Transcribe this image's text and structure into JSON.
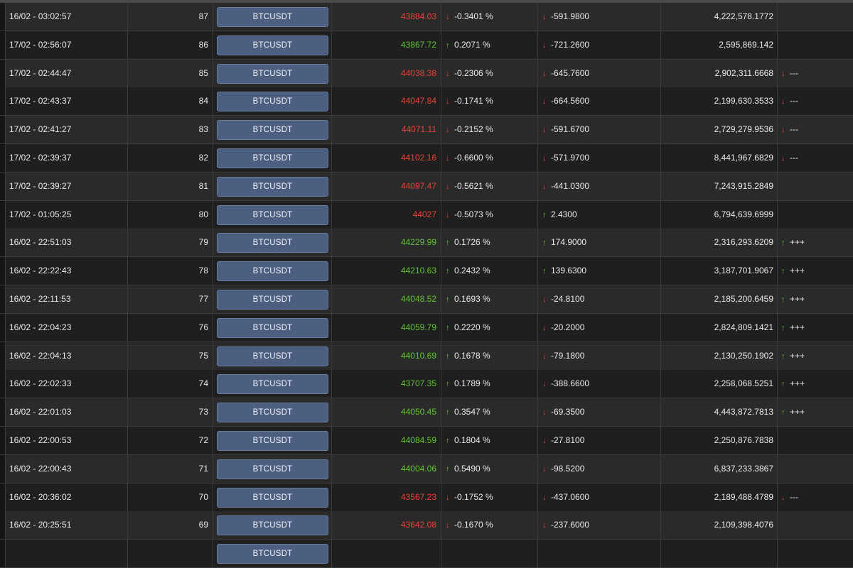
{
  "symbol_label": "BTCUSDT",
  "colors": {
    "up": "#64c23c",
    "down": "#e2463a",
    "button": "#4c5f80"
  },
  "rows": [
    {
      "time": "16/02 - 03:02:57",
      "num": "87",
      "price": "43884.03",
      "price_dir": "down",
      "pct": "-0.3401 %",
      "pct_dir": "down",
      "change": "-591.9800",
      "change_dir": "down",
      "volume": "4,222,578.1772",
      "signal": "",
      "signal_dir": ""
    },
    {
      "time": "17/02 - 02:56:07",
      "num": "86",
      "price": "43867.72",
      "price_dir": "up",
      "pct": "0.2071 %",
      "pct_dir": "up",
      "change": "-721.2600",
      "change_dir": "down",
      "volume": "2,595,869.142",
      "signal": "",
      "signal_dir": ""
    },
    {
      "time": "17/02 - 02:44:47",
      "num": "85",
      "price": "44038.38",
      "price_dir": "down",
      "pct": "-0.2306 %",
      "pct_dir": "down",
      "change": "-645.7600",
      "change_dir": "down",
      "volume": "2,902,311.6668",
      "signal": "---",
      "signal_dir": "down"
    },
    {
      "time": "17/02 - 02:43:37",
      "num": "84",
      "price": "44047.84",
      "price_dir": "down",
      "pct": "-0.1741 %",
      "pct_dir": "down",
      "change": "-664.5600",
      "change_dir": "down",
      "volume": "2,199,630.3533",
      "signal": "---",
      "signal_dir": "down"
    },
    {
      "time": "17/02 - 02:41:27",
      "num": "83",
      "price": "44071.11",
      "price_dir": "down",
      "pct": "-0.2152 %",
      "pct_dir": "down",
      "change": "-591.6700",
      "change_dir": "down",
      "volume": "2,729,279.9536",
      "signal": "---",
      "signal_dir": "down"
    },
    {
      "time": "17/02 - 02:39:37",
      "num": "82",
      "price": "44102.16",
      "price_dir": "down",
      "pct": "-0.6600 %",
      "pct_dir": "down",
      "change": "-571.9700",
      "change_dir": "down",
      "volume": "8,441,967.6829",
      "signal": "---",
      "signal_dir": "down"
    },
    {
      "time": "17/02 - 02:39:27",
      "num": "81",
      "price": "44097.47",
      "price_dir": "down",
      "pct": "-0.5621 %",
      "pct_dir": "down",
      "change": "-441.0300",
      "change_dir": "down",
      "volume": "7,243,915.2849",
      "signal": "",
      "signal_dir": ""
    },
    {
      "time": "17/02 - 01:05:25",
      "num": "80",
      "price": "44027",
      "price_dir": "down",
      "pct": "-0.5073 %",
      "pct_dir": "down",
      "change": "2.4300",
      "change_dir": "up",
      "volume": "6,794,639.6999",
      "signal": "",
      "signal_dir": ""
    },
    {
      "time": "16/02 - 22:51:03",
      "num": "79",
      "price": "44229.99",
      "price_dir": "up",
      "pct": "0.1726 %",
      "pct_dir": "up",
      "change": "174.9000",
      "change_dir": "up",
      "volume": "2,316,293.6209",
      "signal": "+++",
      "signal_dir": "up"
    },
    {
      "time": "16/02 - 22:22:43",
      "num": "78",
      "price": "44210.63",
      "price_dir": "up",
      "pct": "0.2432 %",
      "pct_dir": "up",
      "change": "139.6300",
      "change_dir": "up",
      "volume": "3,187,701.9067",
      "signal": "+++",
      "signal_dir": "up"
    },
    {
      "time": "16/02 - 22:11:53",
      "num": "77",
      "price": "44048.52",
      "price_dir": "up",
      "pct": "0.1693 %",
      "pct_dir": "up",
      "change": "-24.8100",
      "change_dir": "down",
      "volume": "2,185,200.6459",
      "signal": "+++",
      "signal_dir": "up"
    },
    {
      "time": "16/02 - 22:04:23",
      "num": "76",
      "price": "44059.79",
      "price_dir": "up",
      "pct": "0.2220 %",
      "pct_dir": "up",
      "change": "-20.2000",
      "change_dir": "down",
      "volume": "2,824,809.1421",
      "signal": "+++",
      "signal_dir": "up"
    },
    {
      "time": "16/02 - 22:04:13",
      "num": "75",
      "price": "44010.69",
      "price_dir": "up",
      "pct": "0.1678 %",
      "pct_dir": "up",
      "change": "-79.1800",
      "change_dir": "down",
      "volume": "2,130,250.1902",
      "signal": "+++",
      "signal_dir": "up"
    },
    {
      "time": "16/02 - 22:02:33",
      "num": "74",
      "price": "43707.35",
      "price_dir": "up",
      "pct": "0.1789 %",
      "pct_dir": "up",
      "change": "-388.6600",
      "change_dir": "down",
      "volume": "2,258,068.5251",
      "signal": "+++",
      "signal_dir": "up"
    },
    {
      "time": "16/02 - 22:01:03",
      "num": "73",
      "price": "44050.45",
      "price_dir": "up",
      "pct": "0.3547 %",
      "pct_dir": "up",
      "change": "-69.3500",
      "change_dir": "down",
      "volume": "4,443,872.7813",
      "signal": "+++",
      "signal_dir": "up"
    },
    {
      "time": "16/02 - 22:00:53",
      "num": "72",
      "price": "44084.59",
      "price_dir": "up",
      "pct": "0.1804 %",
      "pct_dir": "up",
      "change": "-27.8100",
      "change_dir": "down",
      "volume": "2,250,876.7838",
      "signal": "",
      "signal_dir": ""
    },
    {
      "time": "16/02 - 22:00:43",
      "num": "71",
      "price": "44004.06",
      "price_dir": "up",
      "pct": "0.5490 %",
      "pct_dir": "up",
      "change": "-98.5200",
      "change_dir": "down",
      "volume": "6,837,233.3867",
      "signal": "",
      "signal_dir": ""
    },
    {
      "time": "16/02 - 20:36:02",
      "num": "70",
      "price": "43567.23",
      "price_dir": "down",
      "pct": "-0.1752 %",
      "pct_dir": "down",
      "change": "-437.0600",
      "change_dir": "down",
      "volume": "2,189,488.4789",
      "signal": "---",
      "signal_dir": "down"
    },
    {
      "time": "16/02 - 20:25:51",
      "num": "69",
      "price": "43642.08",
      "price_dir": "down",
      "pct": "-0.1670 %",
      "pct_dir": "down",
      "change": "-237.6000",
      "change_dir": "down",
      "volume": "2,109,398.4076",
      "signal": "",
      "signal_dir": ""
    },
    {
      "time": "",
      "num": "",
      "price": "",
      "price_dir": "down",
      "pct": "",
      "pct_dir": "down",
      "change": "",
      "change_dir": "down",
      "volume": "",
      "signal": "",
      "signal_dir": ""
    }
  ]
}
